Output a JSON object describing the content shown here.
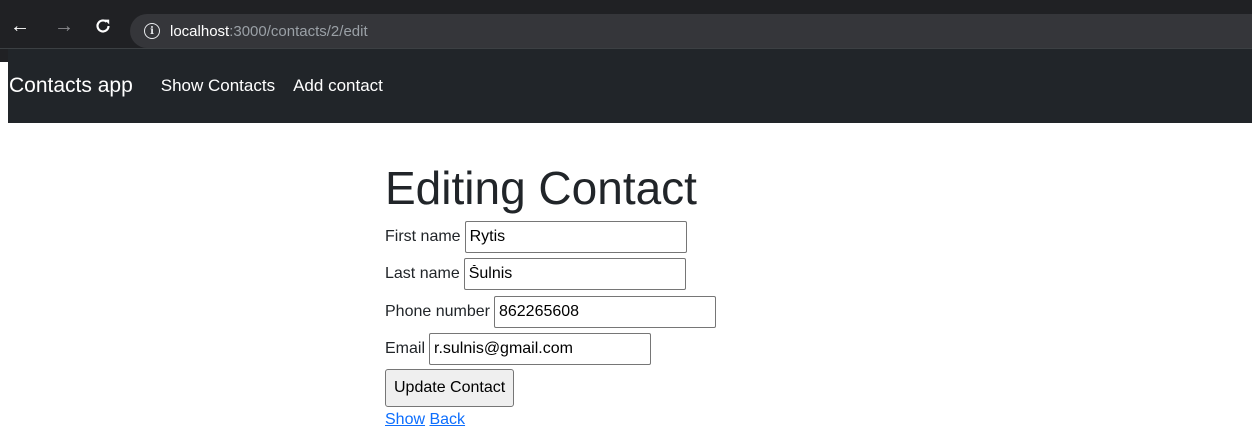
{
  "browser": {
    "back_icon": "arrow-left-icon",
    "forward_icon": "arrow-right-icon",
    "reload_icon": "reload-icon",
    "info_icon": "info-icon",
    "url_host": "localhost",
    "url_path": ":3000/contacts/2/edit"
  },
  "navbar": {
    "brand": "Contacts app",
    "links": [
      "Show Contacts",
      "Add contact"
    ]
  },
  "form": {
    "title": "Editing Contact",
    "fields": [
      {
        "label": "First name",
        "value": "Rytis"
      },
      {
        "label": "Last name",
        "value": "Šulnis"
      },
      {
        "label": "Phone number",
        "value": "862265608"
      },
      {
        "label": "Email",
        "value": "r.sulnis@gmail.com"
      }
    ],
    "submit_label": "Update Contact"
  },
  "footer_links": {
    "show": "Show",
    "back": "Back"
  },
  "colors": {
    "chrome_bg": "#202124",
    "navbar_bg": "#212529",
    "link": "#0d6efd"
  }
}
